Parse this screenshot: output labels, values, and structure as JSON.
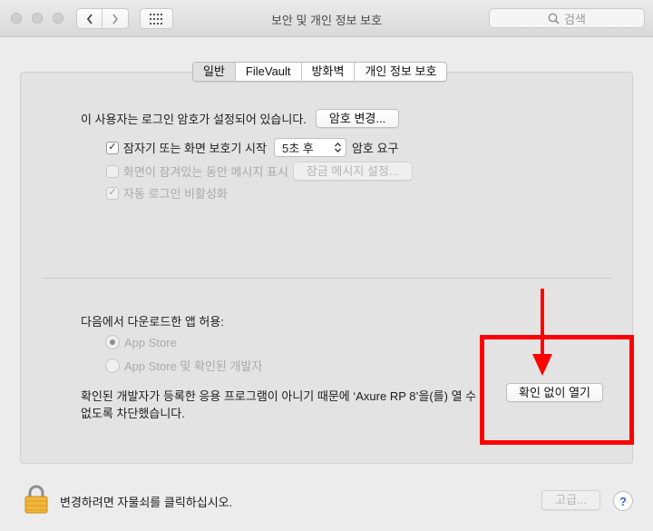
{
  "window": {
    "title": "보안 및 개인 정보 보호",
    "search_placeholder": "검색"
  },
  "tabs": [
    {
      "label": "일반",
      "selected": true
    },
    {
      "label": "FileVault",
      "selected": false
    },
    {
      "label": "방화벽",
      "selected": false
    },
    {
      "label": "개인 정보 보호",
      "selected": false
    }
  ],
  "general": {
    "password_text": "이 사용자는 로그인 암호가 설정되어 있습니다.",
    "change_password_button": "암호 변경...",
    "require_password": {
      "checked": true,
      "label": "잠자기 또는 화면 보호기 시작",
      "delay": "5초 후",
      "suffix": "암호 요구"
    },
    "show_message": {
      "checked": false,
      "enabled": false,
      "label": "화면이 잠겨있는 동안 메시지 표시",
      "button": "잠금 메시지 설정..."
    },
    "disable_autologin": {
      "checked": true,
      "enabled": false,
      "label": "자동 로그인 비활성화"
    }
  },
  "downloads": {
    "heading": "다음에서 다운로드한 앱 허용:",
    "options": [
      {
        "label": "App Store",
        "selected": true
      },
      {
        "label": "App Store 및 확인된 개발자",
        "selected": false
      }
    ],
    "blocked_line1": "확인된 개발자가 등록한 응용 프로그램이 아니기 때문에 ‘Axure RP 8’을(를) 열 수",
    "blocked_line2": "없도록 차단했습니다.",
    "open_anyway_button": "확인 없이 열기"
  },
  "annotation": {
    "color": "#ff0000"
  },
  "footer": {
    "lock_text": "변경하려면 자물쇠를 클릭하십시오.",
    "advanced_button": "고급...",
    "help_label": "?"
  }
}
